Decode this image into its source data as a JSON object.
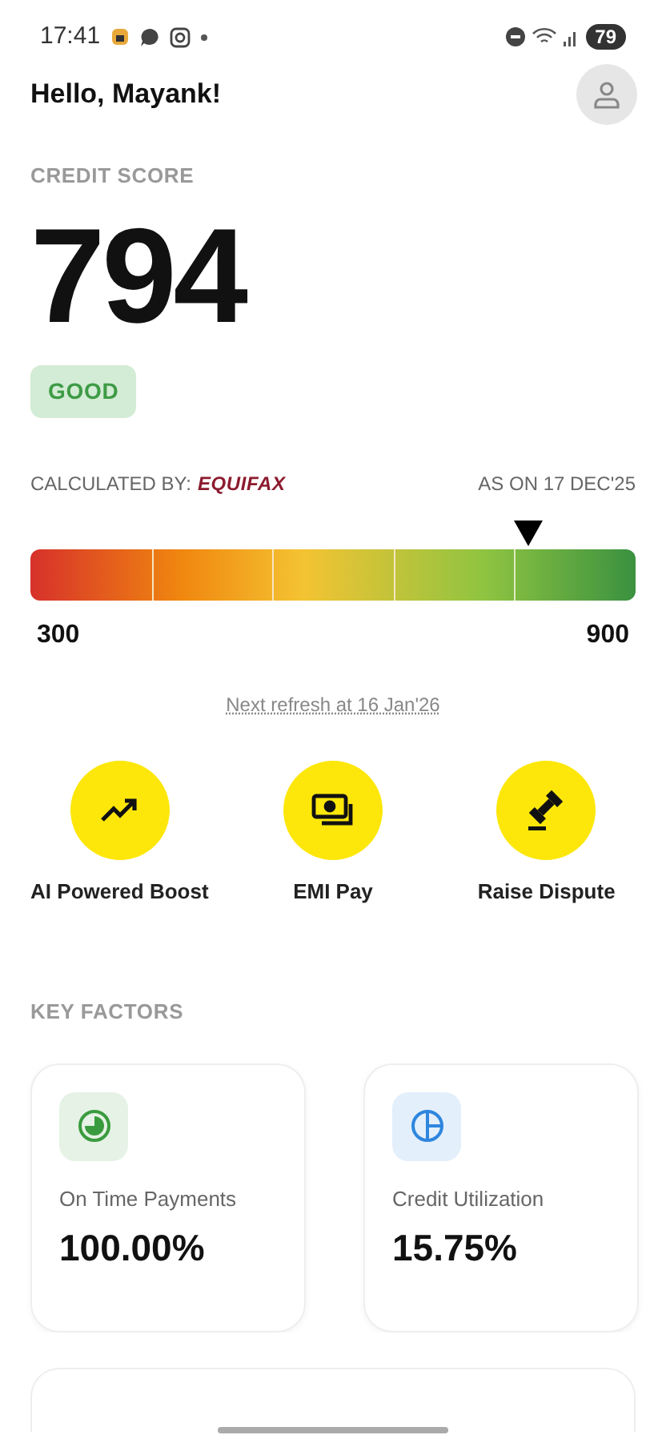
{
  "status_bar": {
    "time": "17:41",
    "battery": "79"
  },
  "greeting": "Hello, Mayank!",
  "credit_score": {
    "heading": "CREDIT SCORE",
    "score": "794",
    "rating": "GOOD",
    "calculated_by": "CALCULATED BY:",
    "bureau": "EQUIFAX",
    "as_on": "AS ON 17 DEC'25",
    "level": 0.823,
    "min": "300",
    "max": "900",
    "next_refresh": "Next refresh at 16 Jan'26"
  },
  "actions": [
    {
      "kind": "boost",
      "label": "AI Powered Boost"
    },
    {
      "kind": "emi",
      "label": "EMI Pay"
    },
    {
      "kind": "dispute",
      "label": "Raise Dispute"
    }
  ],
  "key_factors": {
    "heading": "KEY FACTORS",
    "items": [
      {
        "kind": "payments",
        "label": "On Time Payments",
        "value": "100.00%",
        "color": "#3a9b3e"
      },
      {
        "kind": "utilization",
        "label": "Credit Utilization",
        "value": "15.75%",
        "color": "#2e86de"
      }
    ]
  }
}
